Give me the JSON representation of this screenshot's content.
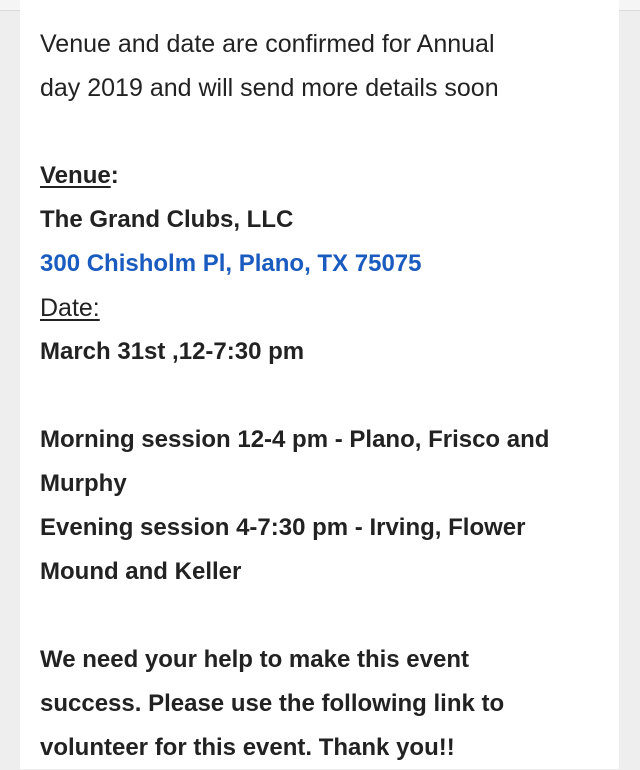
{
  "message": {
    "intro_line1": "Venue and date are confirmed for Annual",
    "intro_line2": "day 2019 and will send more details soon",
    "venue_label": "Venue",
    "venue_colon": ":",
    "venue_name": "The Grand Clubs, LLC",
    "venue_address": "300 Chisholm Pl, Plano, TX 75075",
    "date_label": "Date: ",
    "date_value": "March 31st ,12-7:30 pm",
    "morning_line1": "Morning session 12-4 pm - Plano, Frisco and",
    "morning_line2": "Murphy",
    "evening_line1": "Evening session 4-7:30 pm - Irving, Flower",
    "evening_line2": "Mound and Keller",
    "help_line1": "We need your help to make this event",
    "help_line2": "success. Please use the following link to",
    "help_line3": "volunteer for this event. Thank you!!"
  },
  "colors": {
    "link": "#1a5bbf",
    "text": "#222222",
    "background": "#eeeeef"
  }
}
